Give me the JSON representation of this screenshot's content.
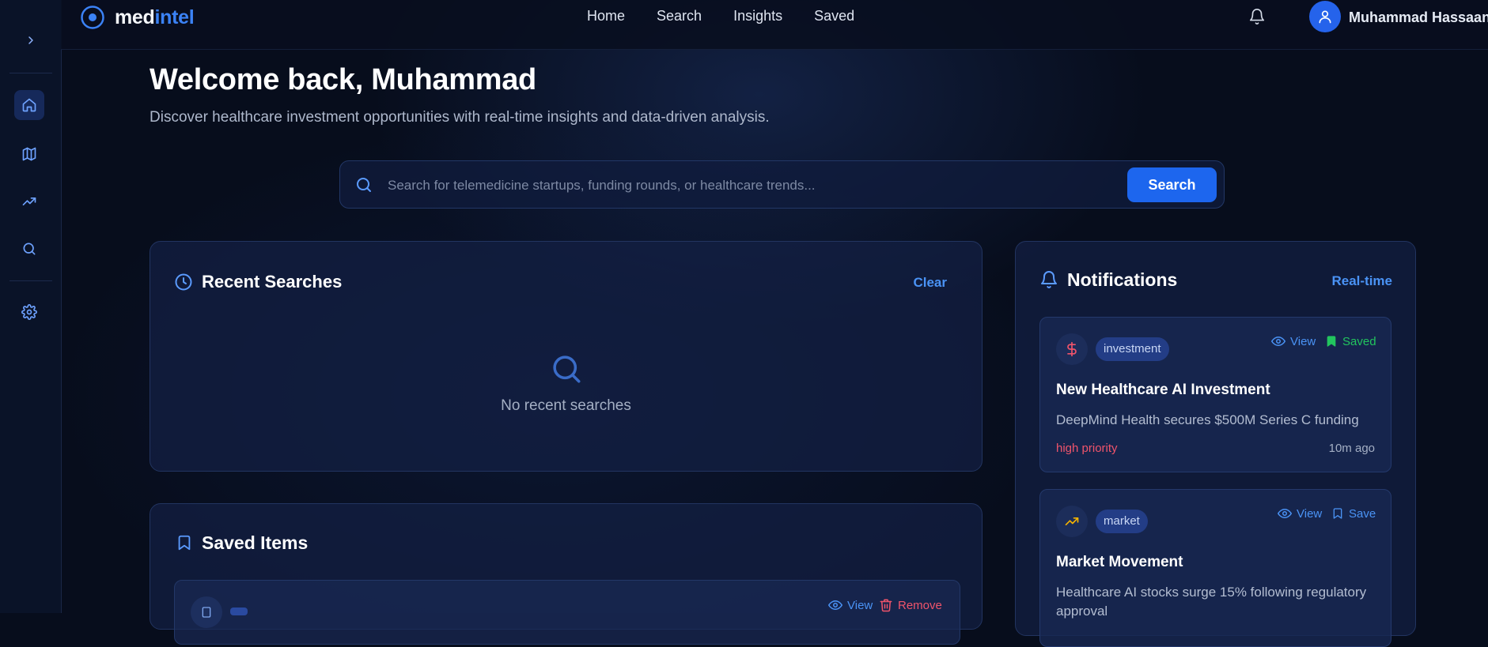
{
  "brand": {
    "part1": "med",
    "part2": "intel"
  },
  "nav": {
    "links": [
      "Home",
      "Search",
      "Insights",
      "Saved"
    ]
  },
  "user": {
    "name": "Muhammad Hassaan S"
  },
  "welcome": {
    "title": "Welcome back, Muhammad",
    "subtitle": "Discover healthcare investment opportunities with real-time insights and data-driven analysis."
  },
  "search": {
    "placeholder": "Search for telemedicine startups, funding rounds, or healthcare trends...",
    "button_label": "Search"
  },
  "recent": {
    "title": "Recent Searches",
    "clear_label": "Clear",
    "empty_text": "No recent searches"
  },
  "saved": {
    "title": "Saved Items",
    "view_label": "View",
    "remove_label": "Remove"
  },
  "notifications": {
    "title": "Notifications",
    "realtime_label": "Real-time",
    "items": [
      {
        "icon": "dollar-icon",
        "tag": "investment",
        "view_label": "View",
        "save_label": "Saved",
        "title": "New Healthcare AI Investment",
        "description": "DeepMind Health secures $500M Series C funding",
        "priority": "high priority",
        "time": "10m ago"
      },
      {
        "icon": "trending-up-icon",
        "tag": "market",
        "view_label": "View",
        "save_label": "Save",
        "title": "Market Movement",
        "description": "Healthcare AI stocks surge 15% following regulatory approval"
      }
    ]
  },
  "colors": {
    "accent": "#1d66ee",
    "link": "#4a93f5",
    "saved_green": "#22c55e",
    "priority_red": "#f0546b",
    "remove_red": "#f0546b",
    "background": "#070d1c"
  }
}
